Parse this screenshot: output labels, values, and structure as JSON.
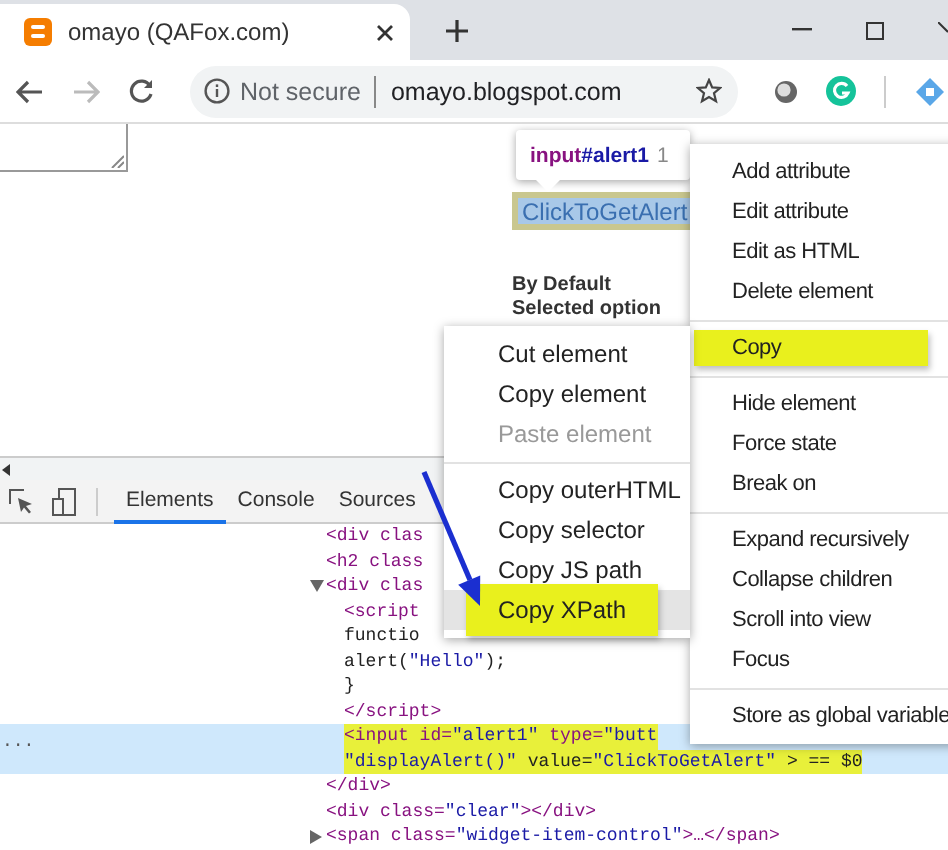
{
  "browser": {
    "tab": {
      "title": "omayo (QAFox.com)"
    },
    "address": {
      "security": "Not secure",
      "url": "omayo.blogspot.com"
    }
  },
  "page": {
    "tooltip": {
      "tag": "input",
      "id": "#alert1",
      "size": "1"
    },
    "button": "ClickToGetAlert",
    "text": "By Default Selected option"
  },
  "devtools": {
    "tabs": [
      {
        "label": "Elements",
        "selected": true
      },
      {
        "label": "Console",
        "selected": false
      },
      {
        "label": "Sources",
        "selected": false
      }
    ],
    "gutter": "...",
    "dom_tree": [
      {
        "lines": [
          "<div clas"
        ],
        "selected": false,
        "highlighted": false
      },
      {
        "lines": [
          "<h2 class"
        ],
        "selected": false,
        "highlighted": false
      },
      {
        "expanded": true,
        "lines": [
          "<div clas"
        ],
        "selected": false,
        "highlighted": false,
        "children": [
          {
            "lines": [
              "<script"
            ],
            "selected": false,
            "highlighted": false
          },
          {
            "lines": [
              "functio"
            ],
            "selected": false,
            "highlighted": false
          },
          {
            "lines": [
              "alert(\"Hello\");"
            ],
            "selected": false,
            "highlighted": false
          },
          {
            "lines": [
              "}"
            ],
            "selected": false,
            "highlighted": false
          },
          {
            "lines": [
              "</script>"
            ],
            "selected": false,
            "highlighted": false
          },
          {
            "lines": [
              "<input id=\"alert1\" type=\"butt",
              "\"displayAlert()\" value=\"ClickToGetAlert\" > == $0"
            ],
            "selected": true,
            "highlighted": true
          }
        ]
      },
      {
        "lines": [
          "</div>"
        ],
        "selected": false,
        "highlighted": false
      },
      {
        "lines": [
          "<div class=\"clear\"></div>"
        ],
        "selected": false,
        "highlighted": false
      },
      {
        "expanded": false,
        "lines": [
          "<span class=\"widget-item-control\">…</span>"
        ],
        "selected": false,
        "highlighted": false
      }
    ]
  },
  "context_menu": {
    "items": [
      {
        "kind": "item",
        "label": "Add attribute",
        "highlighted": false
      },
      {
        "kind": "item",
        "label": "Edit attribute",
        "highlighted": false
      },
      {
        "kind": "item",
        "label": "Edit as HTML",
        "highlighted": false
      },
      {
        "kind": "item",
        "label": "Delete element",
        "highlighted": false
      },
      {
        "kind": "separator"
      },
      {
        "kind": "item",
        "label": "Copy",
        "highlighted": true
      },
      {
        "kind": "separator"
      },
      {
        "kind": "item",
        "label": "Hide element",
        "highlighted": false
      },
      {
        "kind": "item",
        "label": "Force state",
        "highlighted": false
      },
      {
        "kind": "item",
        "label": "Break on",
        "highlighted": false
      },
      {
        "kind": "separator"
      },
      {
        "kind": "item",
        "label": "Expand recursively",
        "highlighted": false
      },
      {
        "kind": "item",
        "label": "Collapse children",
        "highlighted": false
      },
      {
        "kind": "item",
        "label": "Scroll into view",
        "highlighted": false
      },
      {
        "kind": "item",
        "label": "Focus",
        "highlighted": false
      },
      {
        "kind": "separator"
      },
      {
        "kind": "item",
        "label": "Store as global variable",
        "highlighted": false
      }
    ]
  },
  "copy_submenu": {
    "items": [
      {
        "kind": "item",
        "label": "Cut element",
        "disabled": false,
        "hovered": false,
        "highlighted": false
      },
      {
        "kind": "item",
        "label": "Copy element",
        "disabled": false,
        "hovered": false,
        "highlighted": false
      },
      {
        "kind": "item",
        "label": "Paste element",
        "disabled": true,
        "hovered": false,
        "highlighted": false
      },
      {
        "kind": "separator"
      },
      {
        "kind": "item",
        "label": "Copy outerHTML",
        "disabled": false,
        "hovered": false,
        "highlighted": false
      },
      {
        "kind": "item",
        "label": "Copy selector",
        "disabled": false,
        "hovered": false,
        "highlighted": false
      },
      {
        "kind": "item",
        "label": "Copy JS path",
        "disabled": false,
        "hovered": false,
        "highlighted": false
      },
      {
        "kind": "item",
        "label": "Copy XPath",
        "disabled": false,
        "hovered": true,
        "highlighted": true
      }
    ]
  }
}
